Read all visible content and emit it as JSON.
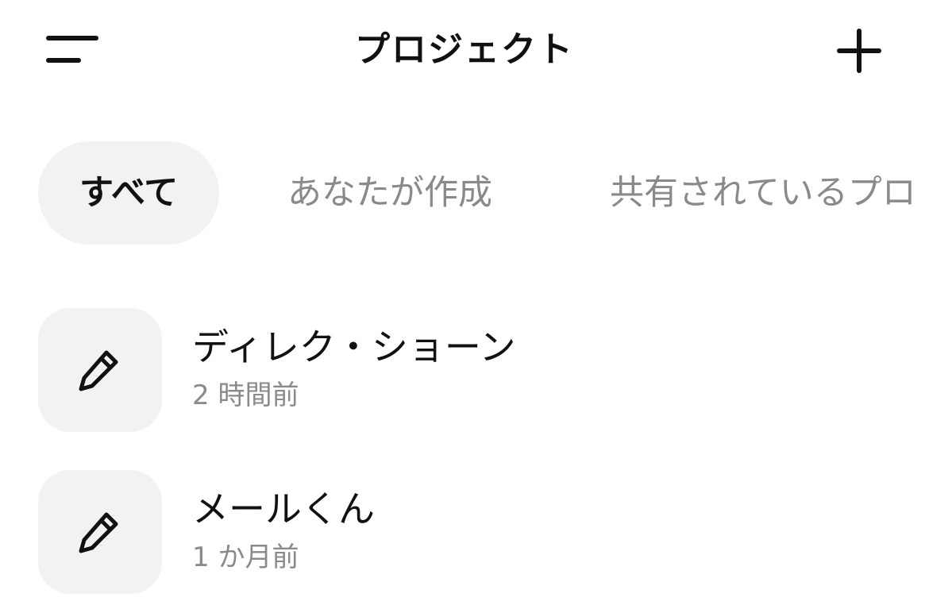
{
  "header": {
    "title": "プロジェクト",
    "menu_icon": "menu-icon",
    "add_icon": "plus-icon"
  },
  "tabs": [
    {
      "label": "すべて",
      "active": true
    },
    {
      "label": "あなたが作成",
      "active": false
    },
    {
      "label": "共有されているプロ",
      "active": false
    }
  ],
  "projects": [
    {
      "name": "ディレク・ショーン",
      "updated": "2 時間前",
      "icon": "pencil-icon"
    },
    {
      "name": "メールくん",
      "updated": "1 か月前",
      "icon": "pencil-icon"
    }
  ],
  "colors": {
    "text_primary": "#111111",
    "text_secondary": "#8a8a8a",
    "chip_background": "#f2f2f2",
    "background": "#ffffff"
  }
}
